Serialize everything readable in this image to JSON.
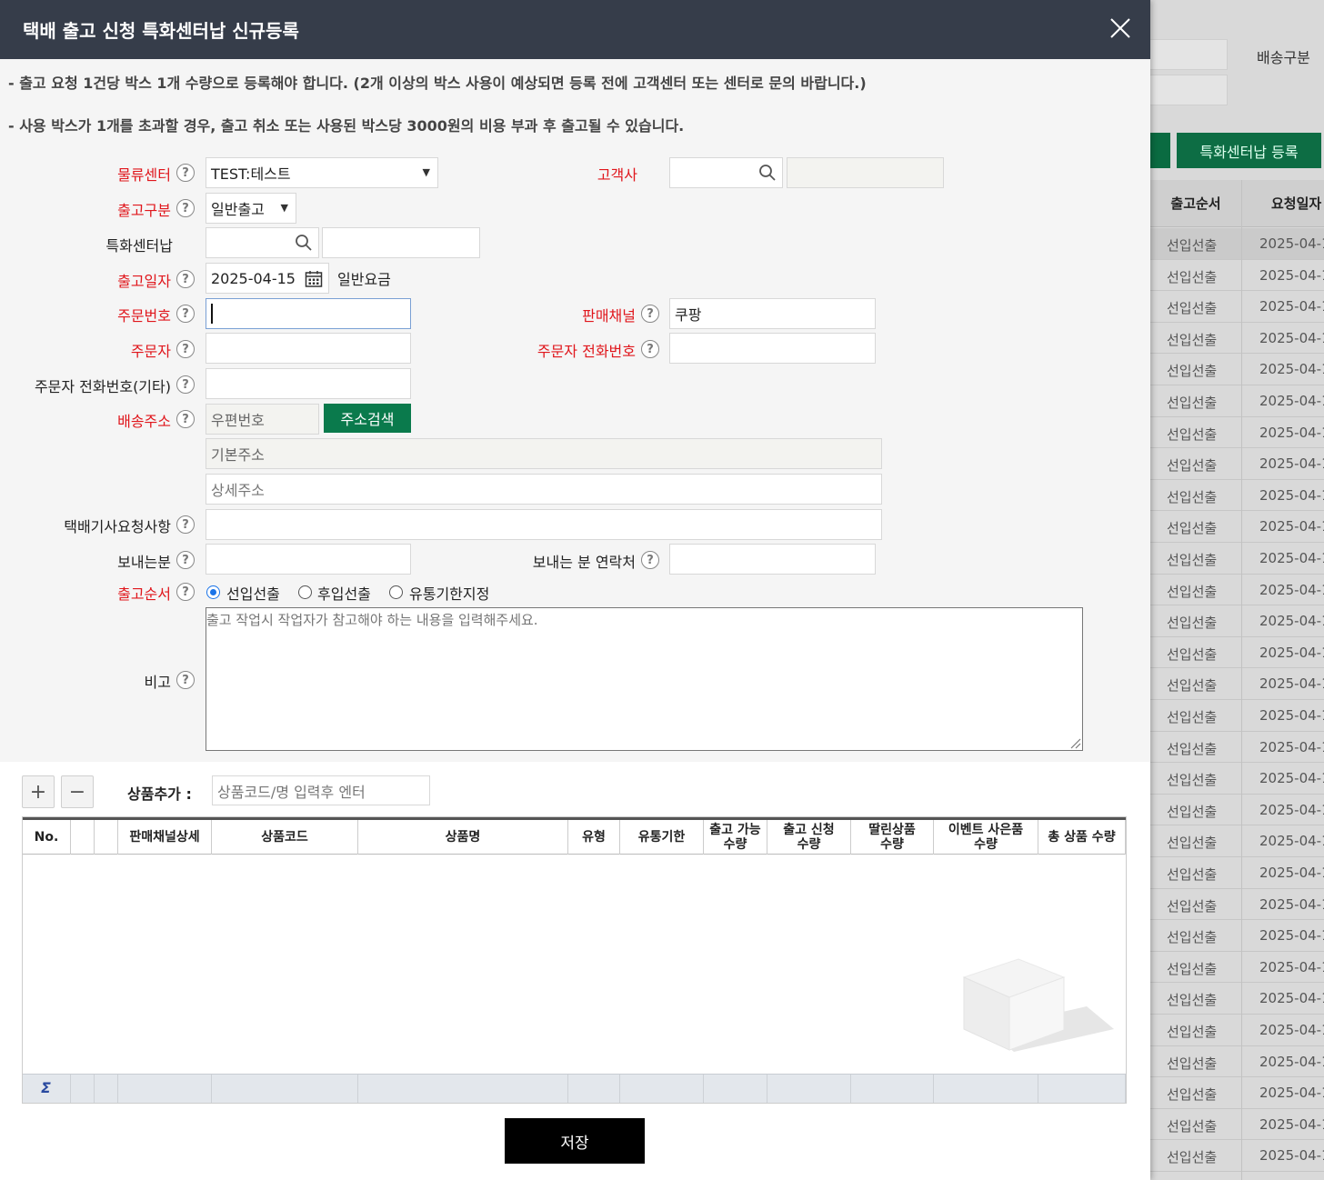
{
  "modal": {
    "title": "택배 출고 신청 특화센터납 신규등록",
    "notices": [
      "- 출고 요청 1건당 박스 1개 수량으로 등록해야 합니다. (2개 이상의 박스 사용이 예상되면 등록 전에 고객센터 또는 센터로 문의 바랍니다.)",
      "- 사용 박스가 1개를 초과할 경우, 출고 취소 또는 사용된 박스당 3000원의 비용 부과 후 출고될 수 있습니다."
    ]
  },
  "form": {
    "help_glyph": "?",
    "logistics_center": {
      "label": "물류센터",
      "value": "TEST:테스트"
    },
    "customer": {
      "label": "고객사",
      "value": "",
      "name_value": ""
    },
    "release_type": {
      "label": "출고구분",
      "value": "일반출고"
    },
    "special_center": {
      "label": "특화센터납",
      "value": "",
      "name_value": ""
    },
    "release_date": {
      "label": "출고일자",
      "value": "2025-04-15",
      "rate_text": "일반요금"
    },
    "order_no": {
      "label": "주문번호",
      "value": ""
    },
    "sales_channel": {
      "label": "판매채널",
      "value": "쿠팡"
    },
    "orderer": {
      "label": "주문자",
      "value": ""
    },
    "orderer_phone": {
      "label": "주문자 전화번호",
      "value": ""
    },
    "orderer_phone_other": {
      "label": "주문자 전화번호(기타)",
      "value": ""
    },
    "address": {
      "label": "배송주소",
      "zip_placeholder": "우편번호",
      "search_button": "주소검색",
      "base_placeholder": "기본주소",
      "detail_placeholder": "상세주소"
    },
    "driver_request": {
      "label": "택배기사요청사항",
      "value": ""
    },
    "sender": {
      "label": "보내는분",
      "value": ""
    },
    "sender_contact": {
      "label": "보내는 분 연락처",
      "value": ""
    },
    "release_order": {
      "label": "출고순서",
      "options": [
        "선입선출",
        "후입선출",
        "유통기한지정"
      ],
      "selected": "선입선출"
    },
    "memo": {
      "label": "비고",
      "placeholder": "출고 작업시 작업자가 참고해야 하는 내용을 입력해주세요."
    }
  },
  "products": {
    "add_button": "+",
    "remove_button": "−",
    "add_label": "상품추가 :",
    "search_placeholder": "상품코드/명 입력후 엔터",
    "columns": [
      "No.",
      "",
      "",
      "판매채널상세",
      "상품코드",
      "상품명",
      "유형",
      "유통기한",
      "출고 가능\n수량",
      "출고 신청\n수량",
      "딸린상품\n수량",
      "이벤트 사은품\n수량",
      "총 상품 수량"
    ],
    "rows": [],
    "footer_symbol": "Σ"
  },
  "save_button": "저장",
  "background": {
    "label_delivery_type": "배송구분",
    "button_register": "특화센터납 등록",
    "col_release_order": "출고순서",
    "col_request_date": "요청일자",
    "row_order": "선입선출",
    "row_date": "2025-04-1",
    "row_count": 30
  },
  "colors": {
    "header": "#363d4a",
    "accent_green": "#0a7a4c",
    "required": "#e0161c",
    "save": "#000000"
  }
}
